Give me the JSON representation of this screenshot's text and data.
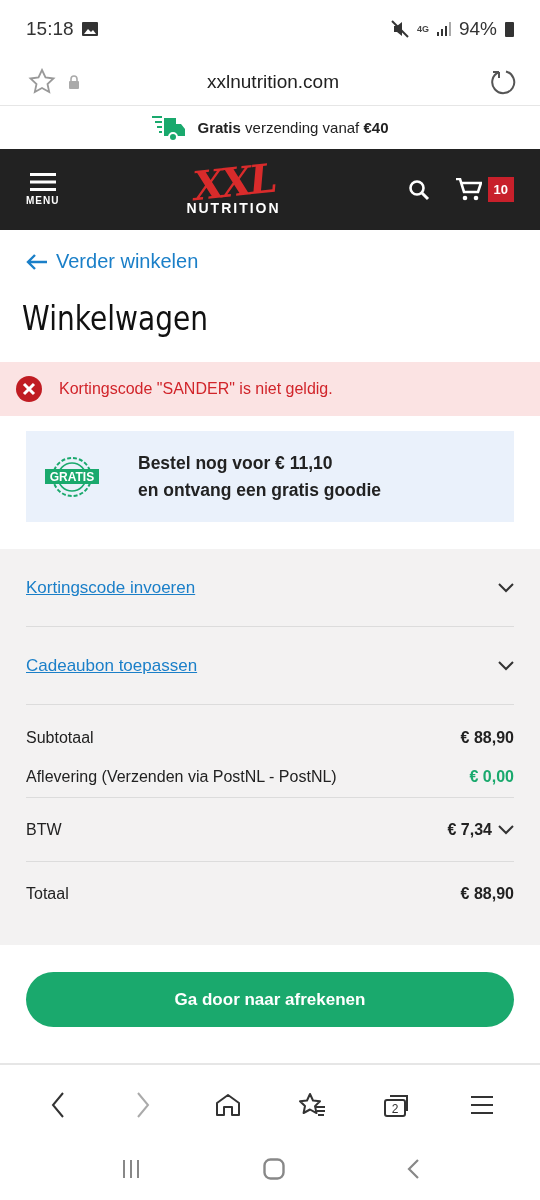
{
  "status_bar": {
    "time": "15:18",
    "network": "4G",
    "battery": "94%"
  },
  "browser": {
    "url": "xxlnutrition.com"
  },
  "shipping_banner": {
    "text": "**Gratis** verzending vanaf **€40**"
  },
  "header": {
    "menu_label": "MENU",
    "logo_top": "XXL",
    "logo_bottom": "NUTRITION",
    "cart_count": "10"
  },
  "back_link": "Verder winkelen",
  "page_title": "Winkelwagen",
  "error": {
    "message": "Kortingscode \"SANDER\" is niet geldig."
  },
  "goodie": {
    "badge": "GRATIS",
    "line_1": "Bestel nog voor € 11,10",
    "line_2": "en ontvang een gratis goodie"
  },
  "accordions": [
    {
      "label": "Kortingscode invoeren",
      "expanded": false
    },
    {
      "label": "Cadeaubon toepassen",
      "expanded": false
    }
  ],
  "totals": [
    {
      "kind": "plain",
      "label": "Subtotaal",
      "value": "€ 88,90"
    },
    {
      "kind": "free",
      "label": "Aflevering (Verzenden via PostNL - PostNL)",
      "value": "€ 0,00"
    },
    {
      "kind": "expandable",
      "label": "BTW",
      "value": "€ 7,34",
      "expanded": false
    },
    {
      "kind": "total",
      "label": "Totaal",
      "value": "€ 88,90"
    }
  ],
  "checkout_button": "Ga door naar afrekenen",
  "browser_nav": {
    "back_disabled": false,
    "forward_disabled": true,
    "tab_count": "2"
  }
}
